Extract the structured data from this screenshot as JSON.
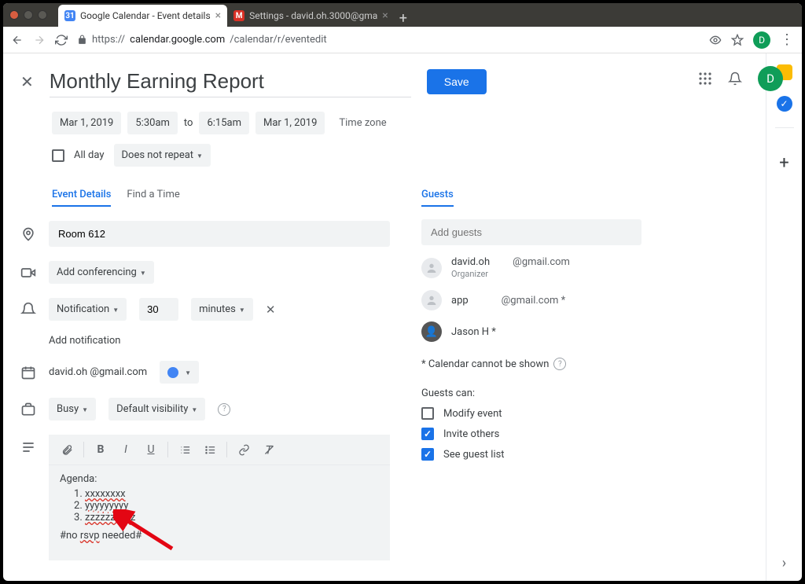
{
  "browser": {
    "tab1_title": "Google Calendar - Event details",
    "tab2_title": "Settings - david.oh.3000@gma",
    "url_path": "/calendar/r/eventedit",
    "url_host": "calendar.google.com",
    "url_scheme": "https://",
    "avatar_letter": "D"
  },
  "event": {
    "title": "Monthly Earning Report",
    "save": "Save",
    "date_start": "Mar 1, 2019",
    "time_start": "5:30am",
    "to": "to",
    "time_end": "6:15am",
    "date_end": "Mar 1, 2019",
    "timezone": "Time zone",
    "all_day": "All day",
    "repeat": "Does not repeat"
  },
  "tabs_left": {
    "details": "Event Details",
    "findtime": "Find a Time"
  },
  "details": {
    "location": "Room 612",
    "conferencing": "Add conferencing",
    "notif_type": "Notification",
    "notif_value": "30",
    "notif_unit": "minutes",
    "add_notif": "Add notification",
    "calendar_owner": "david.oh          @gmail.com",
    "busy": "Busy",
    "visibility": "Default visibility"
  },
  "description": {
    "agenda_label": "Agenda:",
    "items": [
      "xxxxxxxx",
      "yyyyyyyyy",
      "zzzzzzzzzz"
    ],
    "footer": "#no rsvp needed#"
  },
  "guests": {
    "tab": "Guests",
    "placeholder": "Add guests",
    "list": [
      {
        "name": "david.oh",
        "email": "@gmail.com",
        "org": "Organizer"
      },
      {
        "name": "app",
        "email": "@gmail.com *",
        "org": ""
      },
      {
        "name": "Jason H *",
        "email": "",
        "org": ""
      }
    ],
    "warn": "* Calendar cannot be shown",
    "perm_label": "Guests can:",
    "perm_modify": "Modify event",
    "perm_invite": "Invite others",
    "perm_seelist": "See guest list"
  }
}
